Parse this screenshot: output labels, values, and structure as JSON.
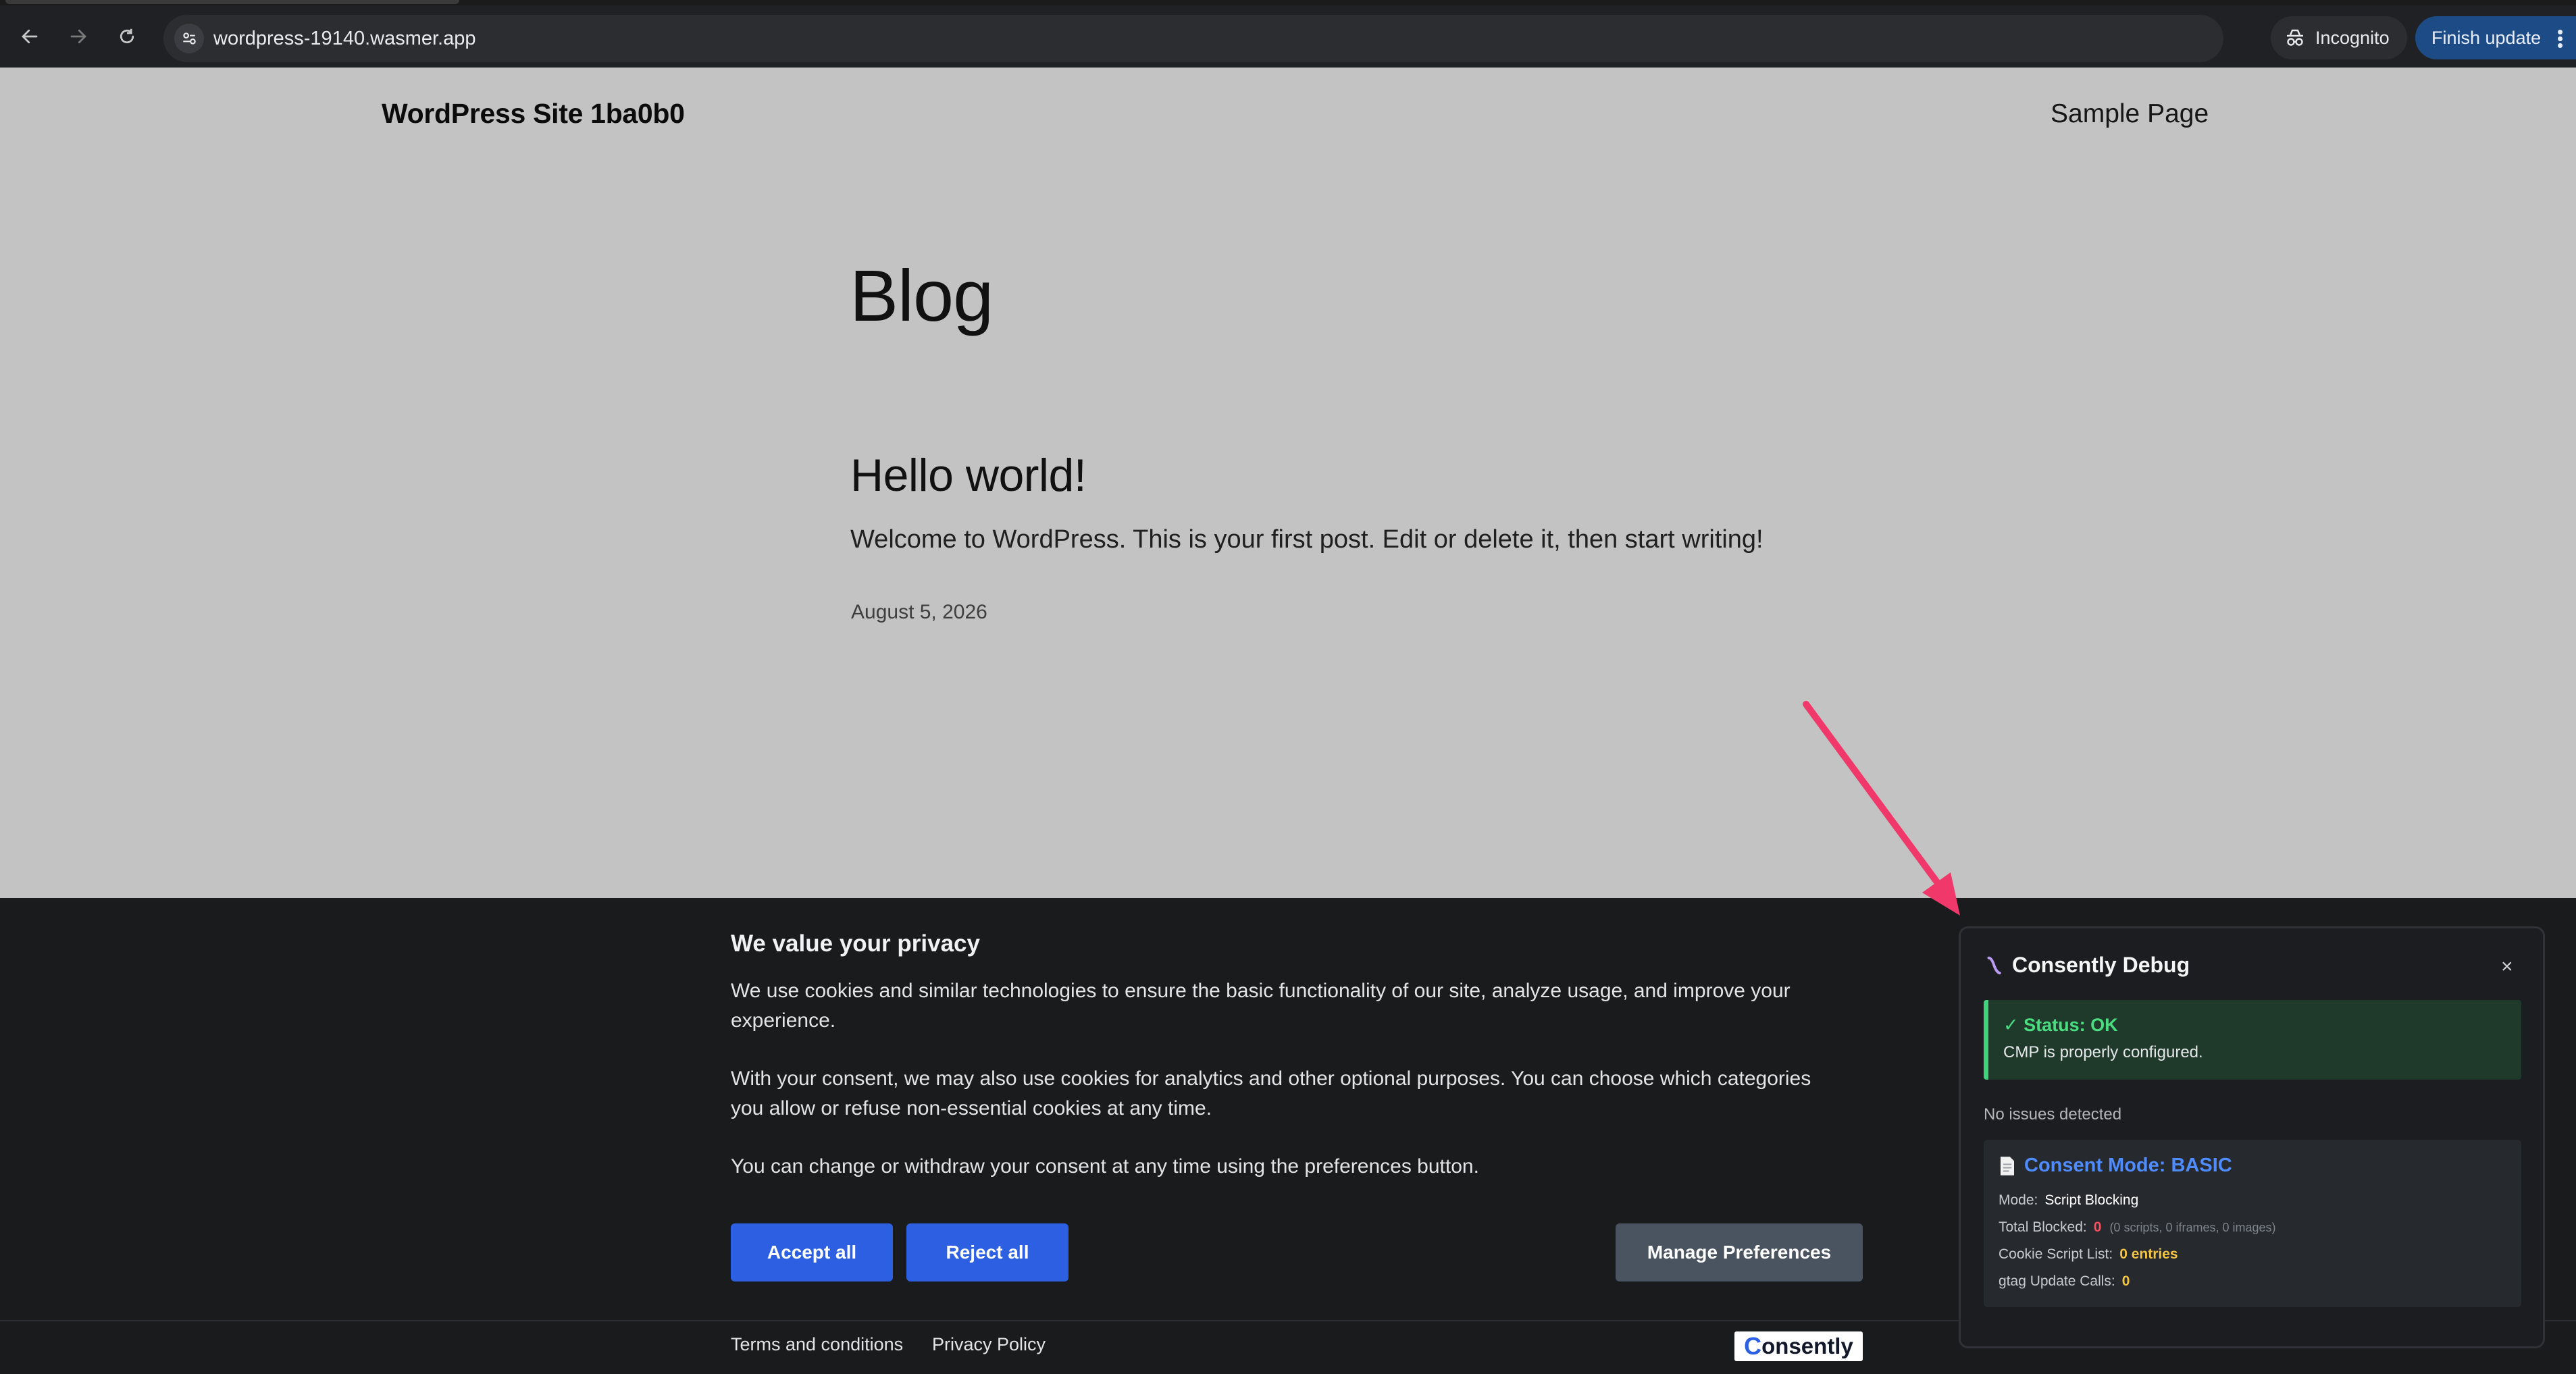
{
  "browser": {
    "url": "wordpress-19140.wasmer.app",
    "incognito_label": "Incognito",
    "finish_update_label": "Finish update"
  },
  "site": {
    "title": "WordPress Site 1ba0b0",
    "nav_link": "Sample Page",
    "page_heading": "Blog",
    "post": {
      "title": "Hello world!",
      "excerpt": "Welcome to WordPress. This is your first post. Edit or delete it, then start writing!",
      "date": "August 5, 2026"
    }
  },
  "cookie_banner": {
    "title": "We value your privacy",
    "paragraph1": "We use cookies and similar technologies to ensure the basic functionality of our site, analyze usage, and improve your experience.",
    "paragraph2": "With your consent, we may also use cookies for analytics and other optional purposes. You can choose which categories you allow or refuse non-essential cookies at any time.",
    "paragraph3": "You can change or withdraw your consent at any time using the preferences button.",
    "accept_label": "Accept all",
    "reject_label": "Reject all",
    "preferences_label": "Manage Preferences",
    "terms_label": "Terms and conditions",
    "privacy_label": "Privacy Policy",
    "logo_text": "onsently",
    "logo_letter": "C"
  },
  "debug_panel": {
    "title": "Consently Debug",
    "close_glyph": "×",
    "status_title": "✓ Status: OK",
    "status_message": "CMP is properly configured.",
    "issues_text": "No issues detected",
    "consent_mode_title": "Consent Mode: BASIC",
    "mode_label": "Mode:",
    "mode_value": "Script Blocking",
    "total_blocked_label": "Total Blocked:",
    "total_blocked_value": "0",
    "total_blocked_detail": "(0 scripts, 0 iframes, 0 images)",
    "cookie_list_label": "Cookie Script List:",
    "cookie_list_value": "0 entries",
    "gtag_label": "gtag Update Calls:",
    "gtag_value": "0"
  },
  "colors": {
    "accent_blue": "#2d5fe3",
    "status_green": "#4ade80",
    "annotation_arrow": "#f0386b"
  }
}
